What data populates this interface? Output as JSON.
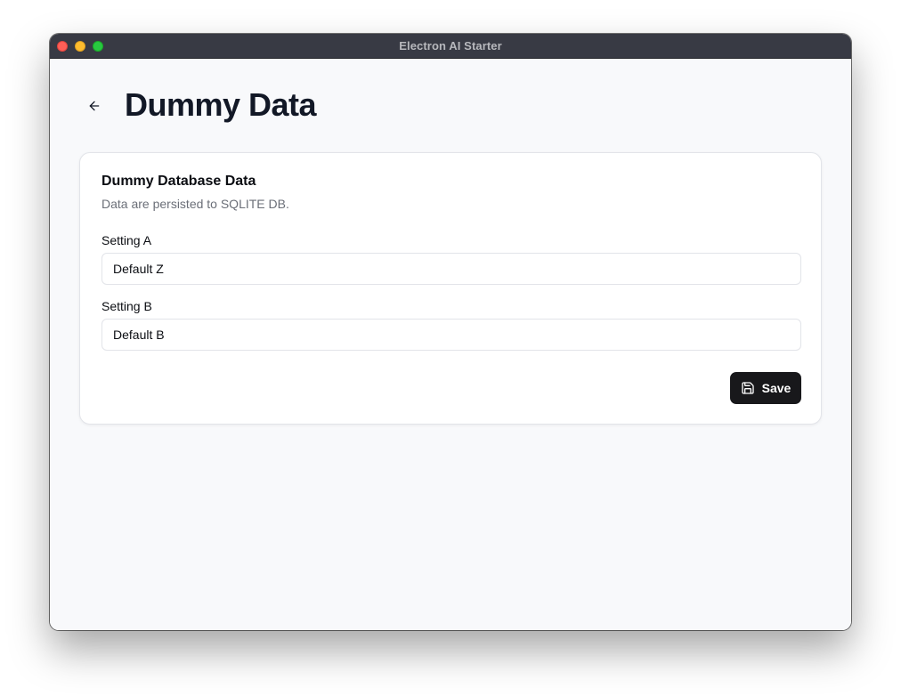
{
  "window": {
    "title": "Electron AI Starter"
  },
  "header": {
    "back_icon": "arrow-left-icon",
    "title": "Dummy Data"
  },
  "card": {
    "title": "Dummy Database Data",
    "description": "Data are persisted to SQLITE DB.",
    "fields": [
      {
        "label": "Setting A",
        "value": "Default Z"
      },
      {
        "label": "Setting B",
        "value": "Default B"
      }
    ],
    "save_label": "Save",
    "save_icon": "save-icon"
  },
  "colors": {
    "titlebar": "#383a44",
    "background": "#f8f9fb",
    "primary_button": "#18181b",
    "close": "#fe5f57",
    "minimize": "#febc2e",
    "maximize": "#28c840"
  }
}
